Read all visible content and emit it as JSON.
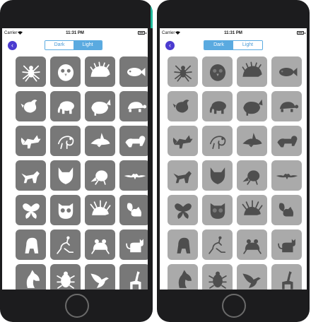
{
  "screens": [
    {
      "status": {
        "carrier": "Carrier",
        "time": "11:31 PM"
      },
      "nav": {
        "back_icon": "chevron-left-icon"
      },
      "segmented": {
        "options": [
          "Dark",
          "Light"
        ],
        "selected": "Light"
      },
      "tile_theme": "dark"
    },
    {
      "status": {
        "carrier": "Carrier",
        "time": "11:31 PM"
      },
      "nav": {
        "back_icon": "chevron-left-icon"
      },
      "segmented": {
        "options": [
          "Dark",
          "Light"
        ],
        "selected": "Dark"
      },
      "tile_theme": "light"
    }
  ],
  "animal_icons": [
    "spider",
    "penguin",
    "hedgehog",
    "fish",
    "bird",
    "elephant",
    "whale",
    "turtle",
    "fox",
    "chameleon",
    "shark",
    "lion",
    "wolf",
    "wolf-head",
    "mole",
    "bat",
    "butterfly",
    "owl",
    "porcupine",
    "squirrel",
    "gorilla",
    "kangaroo",
    "frog",
    "cat",
    "horse-head",
    "beetle",
    "eagle",
    "giraffe"
  ],
  "colors": {
    "dark_tile": "#787878",
    "dark_icon": "#ffffff",
    "light_tile": "#aaaaaa",
    "light_icon": "#4e4e4e",
    "accent": "#5aaae0",
    "back_button": "#4b3bd0"
  }
}
